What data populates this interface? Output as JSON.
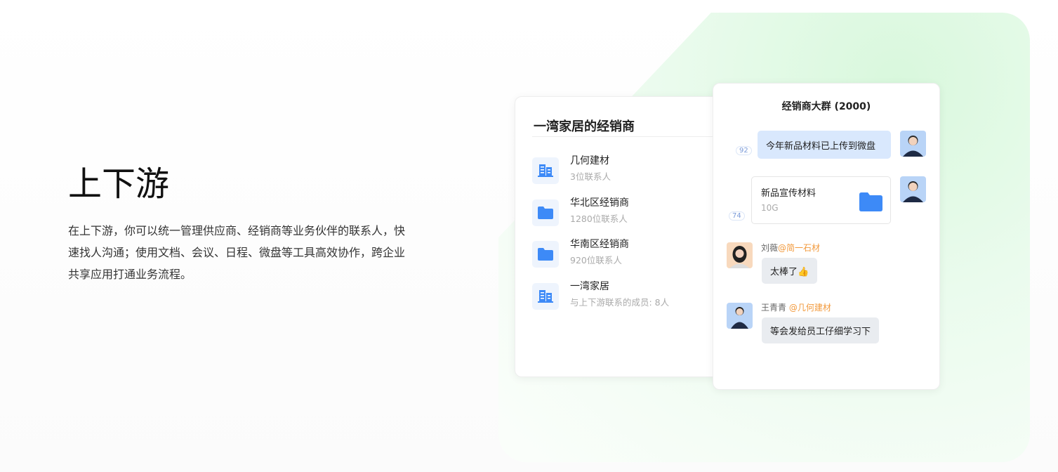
{
  "hero": {
    "title": "上下游",
    "description": "在上下游，你可以统一管理供应商、经销商等业务伙伴的联系人，快速找人沟通；使用文档、会议、日程、微盘等工具高效协作，跨企业共享应用打通业务流程。"
  },
  "partners": {
    "title": "一湾家居的经销商",
    "items": [
      {
        "name": "几何建材",
        "sub": "3位联系人",
        "icon": "building-icon"
      },
      {
        "name": "华北区经销商",
        "sub": "1280位联系人",
        "icon": "folder-icon"
      },
      {
        "name": "华南区经销商",
        "sub": "920位联系人",
        "icon": "folder-icon"
      },
      {
        "name": "一湾家居",
        "sub": "与上下游联系的成员: 8人",
        "icon": "building-icon"
      }
    ]
  },
  "chat": {
    "title": "经销商大群 (2000)",
    "msg1": {
      "text": "今年新品材料已上传到微盘",
      "read": "92"
    },
    "msg2": {
      "file": "新品宣传材料",
      "size": "10G",
      "read": "74"
    },
    "msg3": {
      "user": "刘薇",
      "org": "@简一石材",
      "text": "太棒了👍"
    },
    "msg4": {
      "user": "王青青",
      "org": "@几何建材",
      "text": "等会发给员工仔细学习下"
    }
  },
  "colors": {
    "accent": "#3d8af7",
    "orange": "#f29a3d"
  }
}
